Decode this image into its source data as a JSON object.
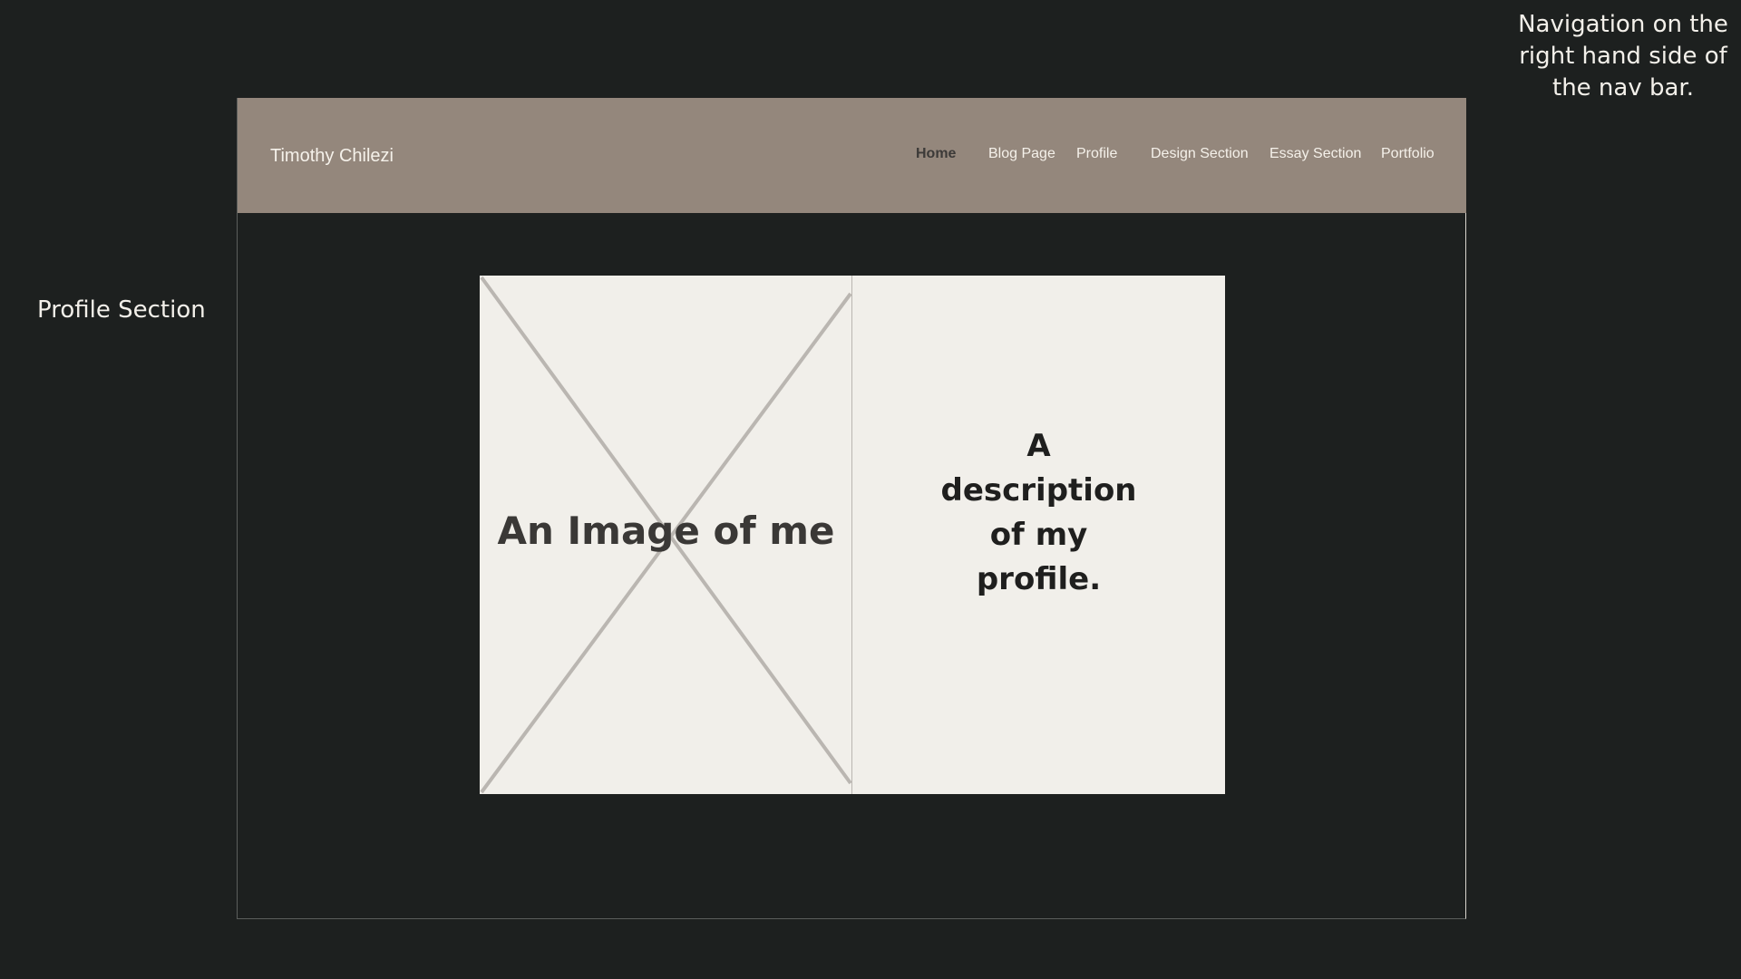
{
  "annotations": {
    "nav_note": "Navigation on the right hand side of the nav bar.",
    "profile_note": "Profile Section"
  },
  "navbar": {
    "brand": "Timothy Chilezi",
    "links": [
      {
        "label": "Home",
        "active": true
      },
      {
        "label": "Blog Page",
        "active": false
      },
      {
        "label": "Profile",
        "active": false
      },
      {
        "label": "Design Section",
        "active": false
      },
      {
        "label": "Essay Section",
        "active": false
      },
      {
        "label": "Portfolio",
        "active": false
      }
    ]
  },
  "profile": {
    "image_caption": "An Image of me",
    "description": "A description of my profile."
  },
  "colors": {
    "background": "#1d201f",
    "navbar": "#94877c",
    "card": "#f1efea",
    "placeholder_lines": "#bab6b1"
  }
}
